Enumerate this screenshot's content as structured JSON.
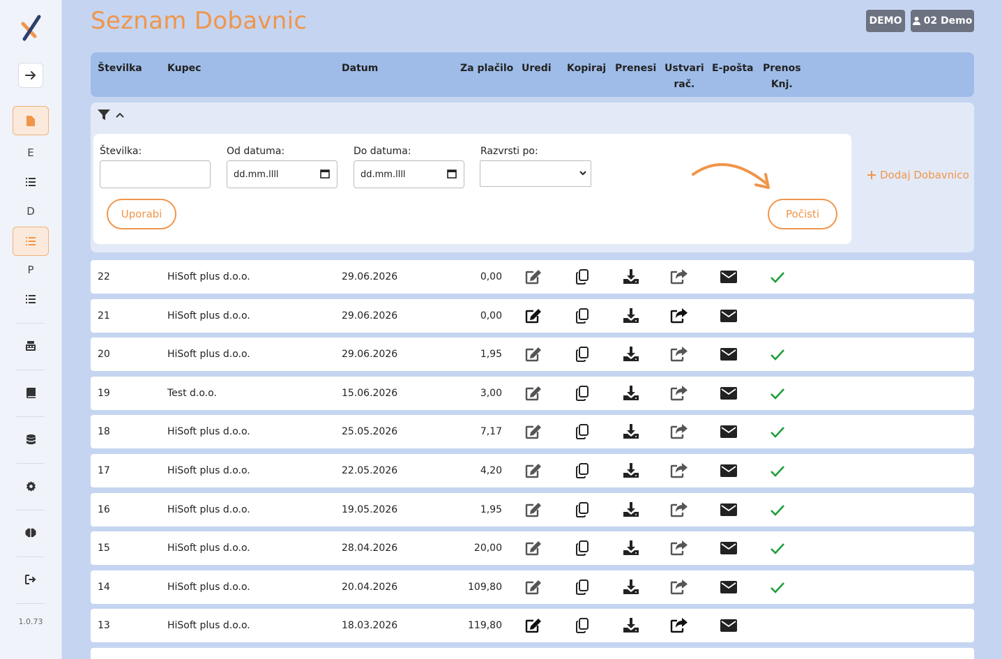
{
  "page_title": "Seznam Dobavnic",
  "header": {
    "demo_badge": "DEMO",
    "user_label": "02 Demo"
  },
  "sidebar": {
    "letters": [
      "E",
      "D",
      "P"
    ],
    "version": "1.0.73"
  },
  "table_headers": {
    "stevilka": "Številka",
    "kupec": "Kupec",
    "datum": "Datum",
    "za_placilo": "Za plačilo",
    "uredi": "Uredi",
    "kopiraj": "Kopiraj",
    "prenesi": "Prenesi",
    "ustvari_line1": "Ustvari",
    "ustvari_line2": "rač.",
    "eposta": "E-pošta",
    "prenos_line1": "Prenos",
    "prenos_line2": "Knj."
  },
  "filters": {
    "stevilka_label": "Številka:",
    "stevilka_value": "",
    "od_label": "Od datuma:",
    "od_value": "dd.mm.llll",
    "do_label": "Do datuma:",
    "do_value": "dd.mm.llll",
    "razvrsti_label": "Razvrsti po:",
    "razvrsti_value": "",
    "apply_label": "Uporabi",
    "clear_label": "Počisti",
    "add_label": "Dodaj Dobavnico"
  },
  "rows": [
    {
      "stevilka": "22",
      "kupec": "HiSoft plus d.o.o.",
      "datum": "29.06.2026",
      "za_placilo": "0,00",
      "locked": true,
      "transferred": true
    },
    {
      "stevilka": "21",
      "kupec": "HiSoft plus d.o.o.",
      "datum": "29.06.2026",
      "za_placilo": "0,00",
      "locked": false,
      "transferred": false
    },
    {
      "stevilka": "20",
      "kupec": "HiSoft plus d.o.o.",
      "datum": "29.06.2026",
      "za_placilo": "1,95",
      "locked": true,
      "transferred": true
    },
    {
      "stevilka": "19",
      "kupec": "Test d.o.o.",
      "datum": "15.06.2026",
      "za_placilo": "3,00",
      "locked": true,
      "transferred": true
    },
    {
      "stevilka": "18",
      "kupec": "HiSoft plus d.o.o.",
      "datum": "25.05.2026",
      "za_placilo": "7,17",
      "locked": true,
      "transferred": true
    },
    {
      "stevilka": "17",
      "kupec": "HiSoft plus d.o.o.",
      "datum": "22.05.2026",
      "za_placilo": "4,20",
      "locked": true,
      "transferred": true
    },
    {
      "stevilka": "16",
      "kupec": "HiSoft plus d.o.o.",
      "datum": "19.05.2026",
      "za_placilo": "1,95",
      "locked": true,
      "transferred": true
    },
    {
      "stevilka": "15",
      "kupec": "HiSoft plus d.o.o.",
      "datum": "28.04.2026",
      "za_placilo": "20,00",
      "locked": true,
      "transferred": true
    },
    {
      "stevilka": "14",
      "kupec": "HiSoft plus d.o.o.",
      "datum": "20.04.2026",
      "za_placilo": "109,80",
      "locked": true,
      "transferred": true
    },
    {
      "stevilka": "13",
      "kupec": "HiSoft plus d.o.o.",
      "datum": "18.03.2026",
      "za_placilo": "119,80",
      "locked": false,
      "transferred": false
    }
  ],
  "colors": {
    "accent": "#f0954a",
    "header_bg": "#9fbce8",
    "page_bg": "#c5d5f1",
    "check": "#1e9e3a"
  }
}
